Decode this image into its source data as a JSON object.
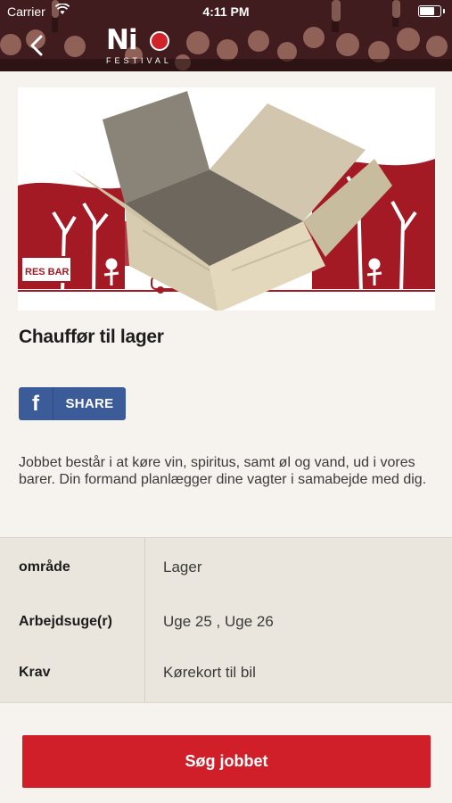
{
  "status_bar": {
    "carrier": "Carrier",
    "time": "4:11 PM"
  },
  "header": {
    "logo_text": "Ni",
    "logo_subtext": "FESTIVAL"
  },
  "banner": {
    "sign_text": "RES BAR"
  },
  "job": {
    "title": "Chauffør til lager",
    "description": "Jobbet består i at køre vin, spiritus, samt øl og vand, ud i vores barer. Din formand planlægger dine vagter i samabejde med dig."
  },
  "share": {
    "label": "SHARE"
  },
  "details": [
    {
      "label": "område",
      "value": "Lager"
    },
    {
      "label": "Arbejdsuge(r)",
      "value": "Uge 25 , Uge 26"
    },
    {
      "label": "Krav",
      "value": "Kørekort til bil"
    }
  ],
  "apply_button": {
    "label": "Søg jobbet"
  },
  "colors": {
    "brand_red": "#d11f2a",
    "facebook_blue": "#3b5b99",
    "page_bg": "#f6f3ee",
    "table_bg": "#ebe6dd"
  }
}
